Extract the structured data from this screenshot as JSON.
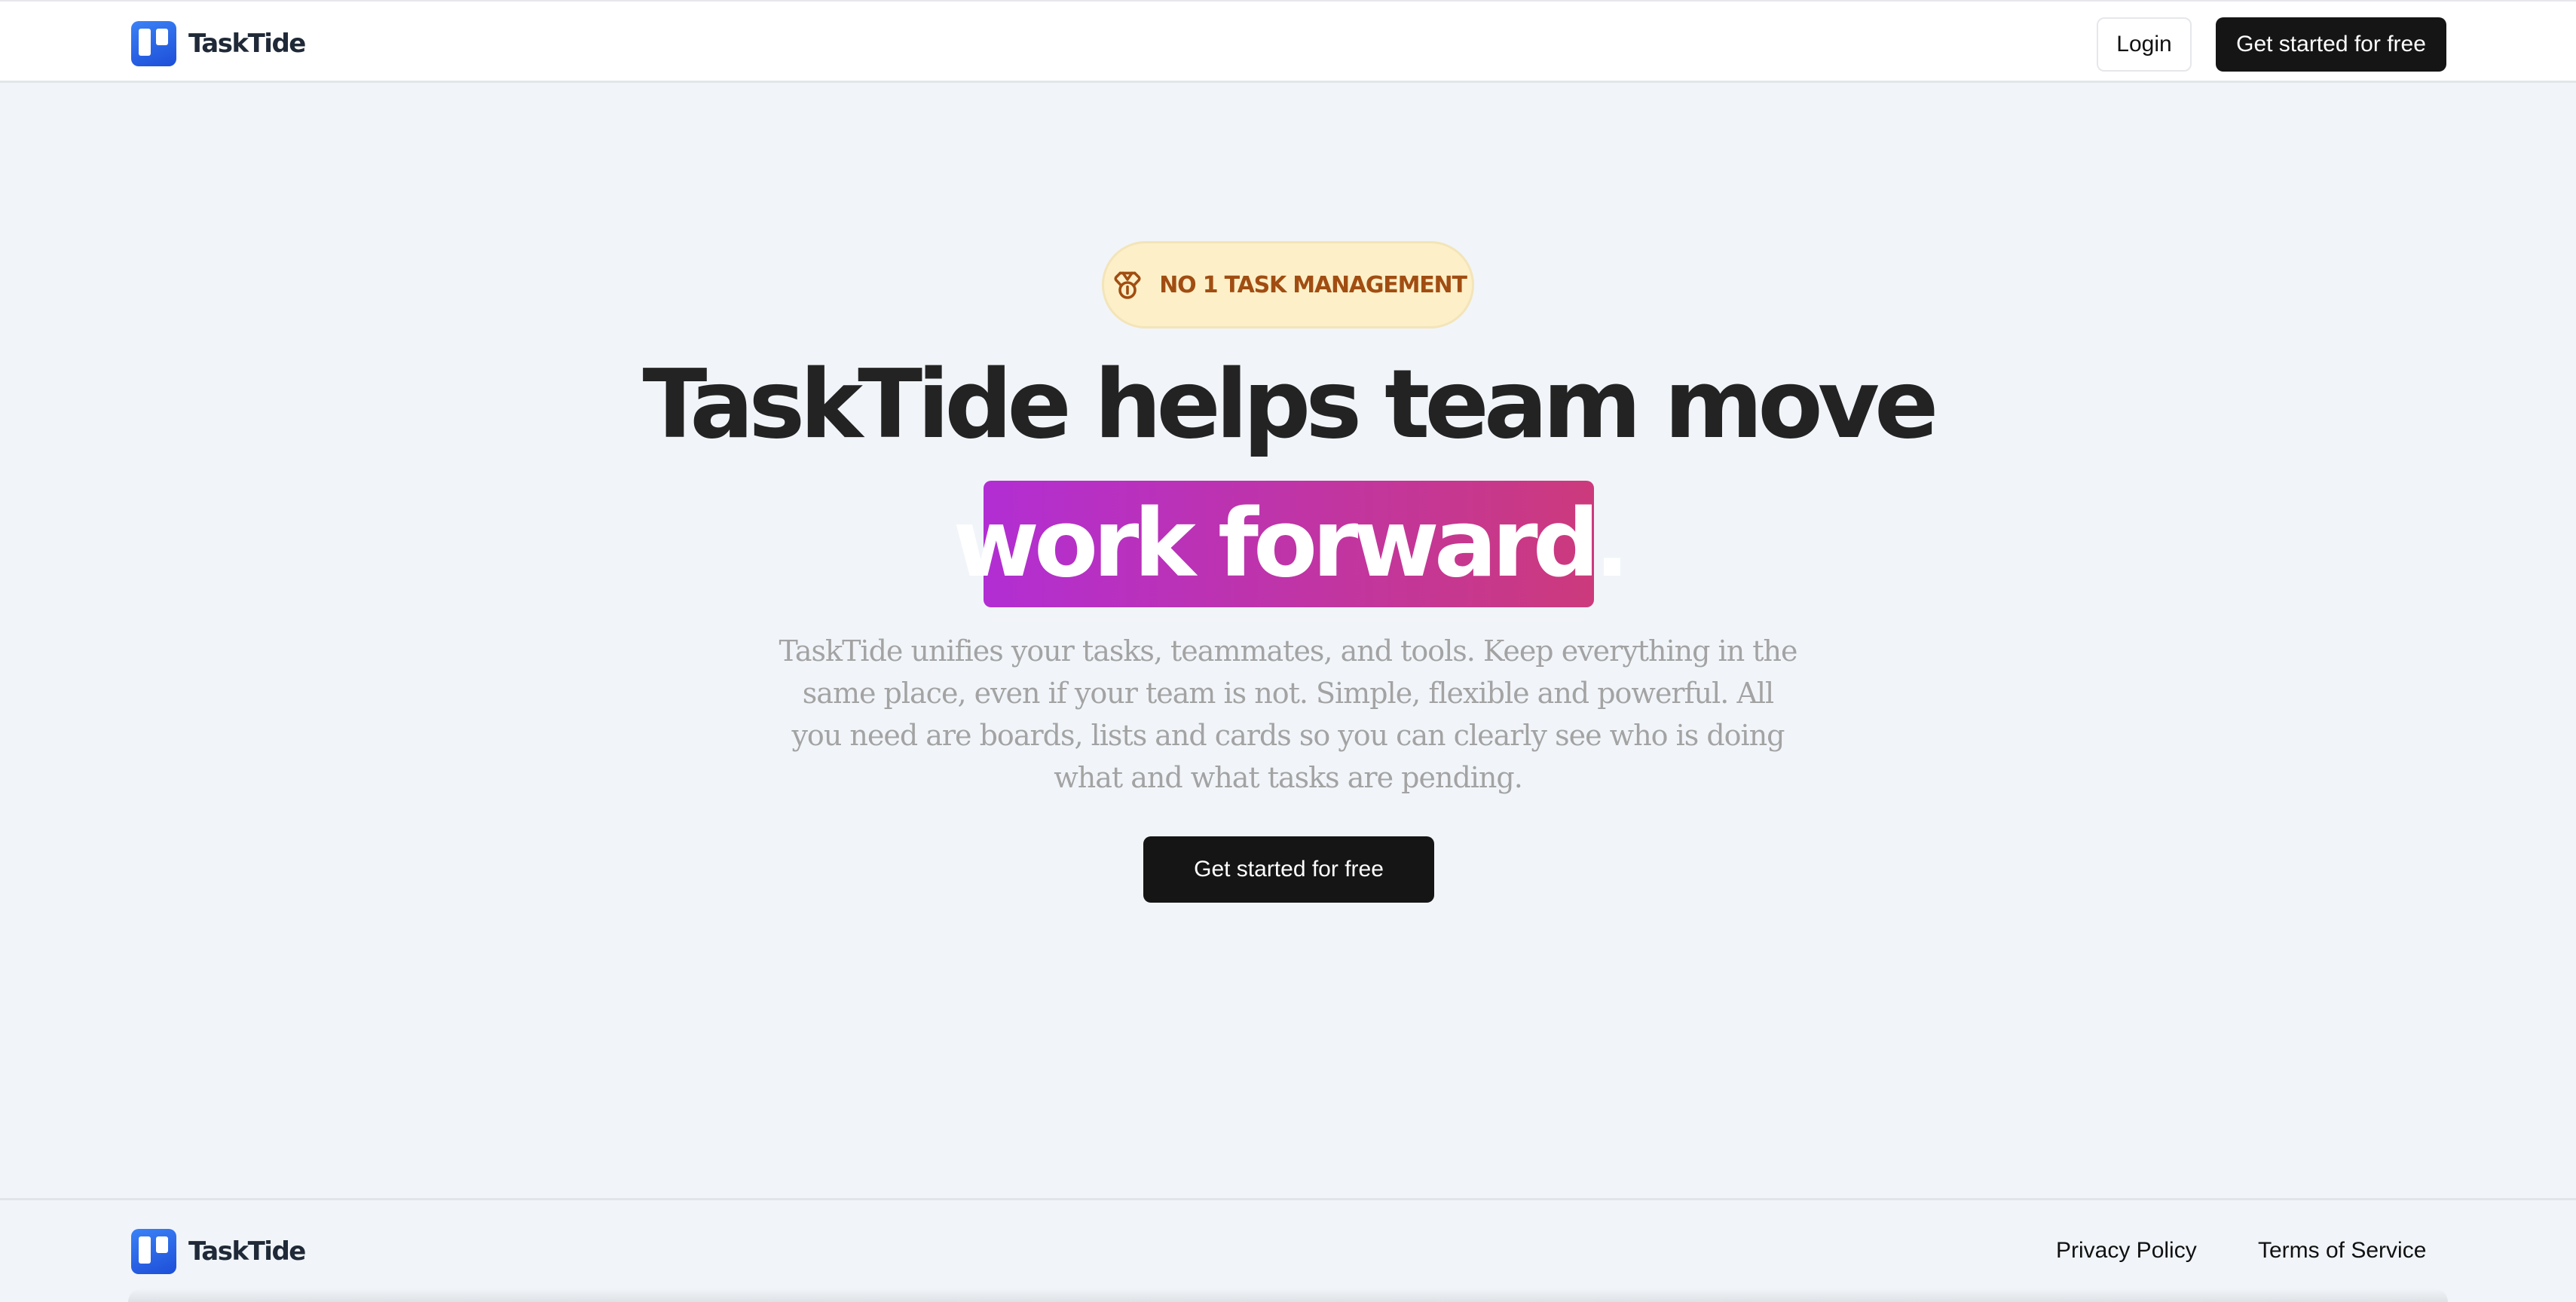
{
  "colors": {
    "page_background": "#f1f5f9",
    "header_background": "#ffffff",
    "dark_button": "#151515",
    "logo_blue": "#2563eb",
    "badge_background": "#fdf0c8",
    "badge_text": "#a14d12",
    "highlight_gradient_start": "#b22ed3",
    "highlight_gradient_end": "#cc3a7c",
    "description_text": "#a3a3a3"
  },
  "header": {
    "logo_icon": "board-columns-icon",
    "brand": "TaskTide",
    "login_label": "Login",
    "cta_label": "Get started for free"
  },
  "hero": {
    "badge_icon": "medal-icon",
    "badge_text": "NO 1 TASK MANAGEMENT",
    "title": "TaskTide helps team move",
    "highlight": "work forward.",
    "description": "TaskTide unifies your tasks, teammates, and tools. Keep everything in the same place, even if your team is not. Simple, flexible and powerful. All you need are boards, lists and cards so you can clearly see who is doing what and what tasks are pending.",
    "cta_label": "Get started for free"
  },
  "footer": {
    "logo_icon": "board-columns-icon",
    "brand": "TaskTide",
    "links": [
      {
        "label": "Privacy Policy"
      },
      {
        "label": "Terms of Service"
      }
    ]
  }
}
